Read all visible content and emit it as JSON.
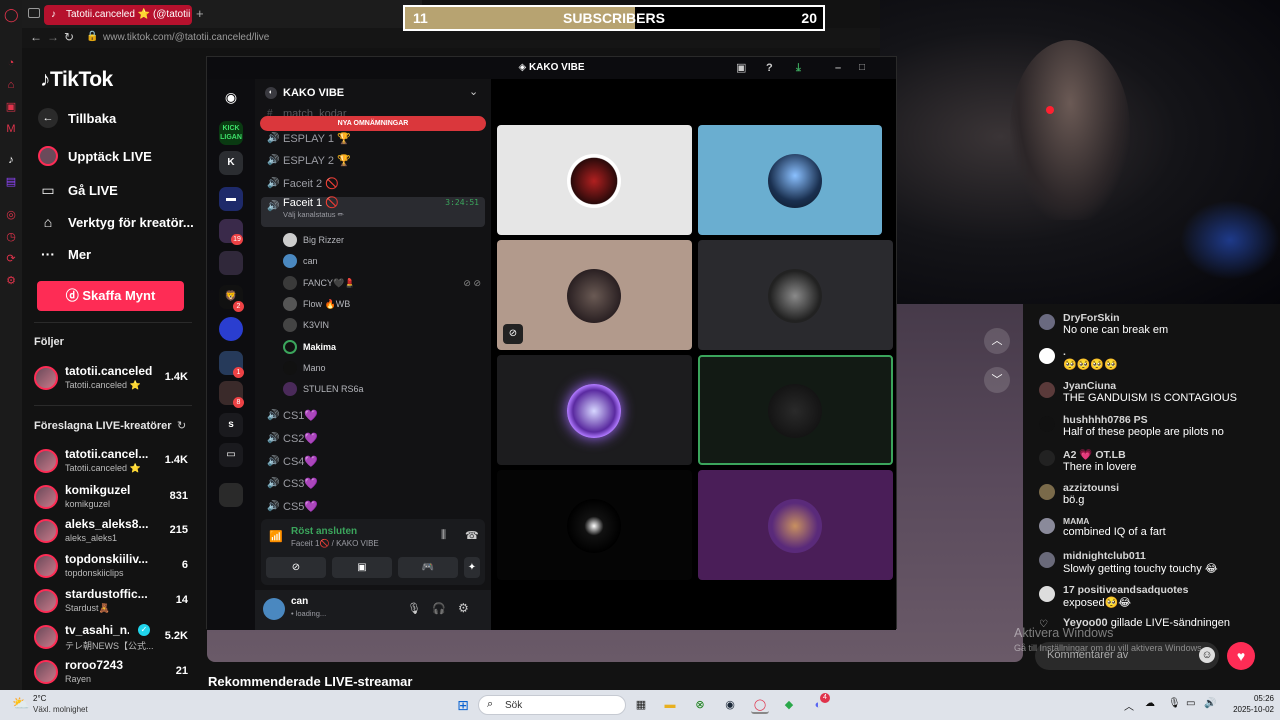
{
  "browser": {
    "tab_title": "Tatotii.canceled ⭐ (@tatotii",
    "new_tab": "+",
    "url": "www.tiktok.com/@tatotii.canceled/live"
  },
  "subscriber_goal": {
    "current": "11",
    "label": "SUBSCRIBERS",
    "goal": "20",
    "progress": 0.55
  },
  "tiktok": {
    "logo": "TikTok",
    "back": "Tillbaka",
    "nav": [
      {
        "label": "Upptäck LIVE",
        "icon": "avatar-icon"
      },
      {
        "label": "Gå LIVE",
        "icon": "camera-icon"
      },
      {
        "label": "Verktyg för kreatör...",
        "icon": "home-icon"
      },
      {
        "label": "Mer",
        "icon": "more-icon"
      }
    ],
    "coins_button": "Skaffa Mynt",
    "following_header": "Följer",
    "following": [
      {
        "name": "tatotii.canceled ...",
        "sub": "Tatotii.canceled ⭐",
        "count": "1.4K"
      }
    ],
    "suggested_header": "Föreslagna LIVE-kreatörer",
    "suggested": [
      {
        "name": "tatotii.cancel...",
        "sub": "Tatotii.canceled ⭐",
        "count": "1.4K"
      },
      {
        "name": "komikguzel",
        "sub": "komikguzel",
        "count": "831"
      },
      {
        "name": "aleks_aleks8...",
        "sub": "aleks_aleks1",
        "count": "215"
      },
      {
        "name": "topdonskiiliv...",
        "sub": "topdonskiiclips",
        "count": "6"
      },
      {
        "name": "stardustoffic...",
        "sub": "Stardust🧸",
        "count": "14"
      },
      {
        "name": "tv_asahi_n...",
        "sub": "テレ朝NEWS【公式...",
        "count": "5.2K"
      },
      {
        "name": "roroo7243",
        "sub": "Rayen",
        "count": "21"
      }
    ],
    "recommended_header": "Rekommenderade LIVE-streamar"
  },
  "discord": {
    "window_title": "KAKO VIBE",
    "server_name": "KAKO VIBE",
    "mentions_banner": "NYA OMNÄMNINGAR",
    "partial_channel": "match_kodar",
    "guild_labels": [
      "K",
      "s"
    ],
    "guild_badges": [
      "19",
      "2",
      "1",
      "8"
    ],
    "channels_top": [
      "ESPLAY 1 🏆",
      "ESPLAY 2 🏆",
      "Faceit 2 🚫"
    ],
    "active_channel": {
      "name": "Faceit 1 🚫",
      "status": "Välj kanalstatus ✏",
      "timer": "3:24:51"
    },
    "users": [
      "Big Rizzer",
      "can",
      "FANCY🖤💄",
      "Flow 🔥WB",
      "K3VIN",
      "Makima",
      "Mano",
      "STULEN RS6a"
    ],
    "channels_bottom": [
      "CS1💜",
      "CS2💜",
      "CS4💜",
      "CS3💜",
      "CS5💜"
    ],
    "voice": {
      "status": "Röst ansluten",
      "location": "Faceit 1🚫 / KAKO VIBE"
    },
    "me": {
      "name": "can",
      "status": "• loading..."
    }
  },
  "chat": {
    "messages": [
      {
        "user": "DryForSkin",
        "text": "No one can break em"
      },
      {
        "user": ".",
        "text": "🥺🥺🥺🥺"
      },
      {
        "user": "JyanCiuna",
        "text": "THE GANDUISM IS CONTAGIOUS"
      },
      {
        "user": "hushhhh0786 PS",
        "text": "Half of these people are pilots no"
      },
      {
        "user": "A2 💗 OT.LB",
        "text": "There in lovere"
      },
      {
        "user": "azziztounsi",
        "text": "bö.g"
      },
      {
        "user": "MAMA",
        "text": "combined IQ of a fart"
      },
      {
        "user": "midnightclub011",
        "text": "Slowly getting touchy touchy 😂"
      },
      {
        "user": "17 positiveandsadquotes",
        "text": "exposed🥺😂"
      }
    ],
    "gift_user": "Yeyoo00",
    "gift_text": "gillade LIVE-sändningen",
    "input_placeholder": "Kommentarer av"
  },
  "windows_activation": {
    "title": "Aktivera Windows",
    "sub": "Gå till Inställningar om du vill aktivera Windows."
  },
  "taskbar": {
    "weather_temp": "2°C",
    "weather_desc": "Växl. molnighet",
    "search": "Sök",
    "time": "05:26",
    "date": "2025-10-02",
    "badge": "4"
  }
}
